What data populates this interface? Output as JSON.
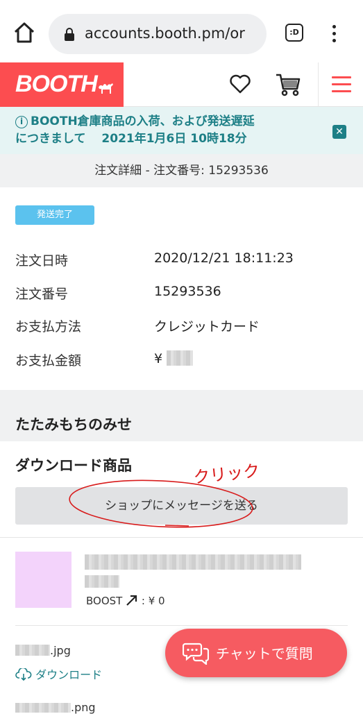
{
  "browser": {
    "url": "accounts.booth.pm/or",
    "tabs_label": ":D"
  },
  "header": {
    "logo": "BOOTH"
  },
  "notice": {
    "line1": "BOOTH倉庫商品の入荷、および発送遅延",
    "line2": "につきまして　 2021年1月6日 10時18分",
    "info_glyph": "i",
    "close_glyph": "✕"
  },
  "order": {
    "title": "注文詳細 - 注文番号: 15293536",
    "status_badge": "発送完了",
    "rows": [
      {
        "label": "注文日時",
        "value": "2020/12/21 18:11:23"
      },
      {
        "label": "注文番号",
        "value": "15293536"
      },
      {
        "label": "お支払方法",
        "value": "クレジットカード"
      },
      {
        "label": "お支払金額",
        "value": "¥"
      }
    ]
  },
  "shop": {
    "name": "たたみもちのみせ",
    "download_title": "ダウンロード商品",
    "message_button": "ショップにメッセージを送る",
    "annotation": "クリック"
  },
  "item": {
    "boost": "BOOST",
    "boost_price": ": ¥ 0",
    "file1_ext": ".jpg",
    "download_link": "ダウンロード",
    "file2_ext": ".png"
  },
  "chat": {
    "label": "チャットで質問"
  },
  "colors": {
    "brand": "#fc4d50",
    "teal": "#1d7f86",
    "badge": "#5bc2ee",
    "chat": "#f65b61"
  }
}
